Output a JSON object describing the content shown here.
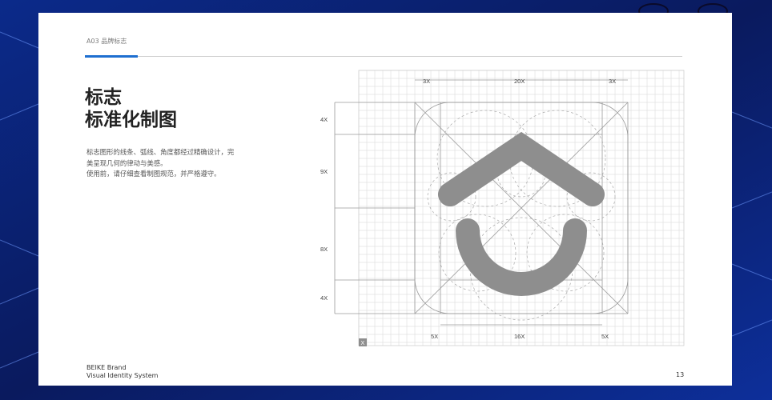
{
  "header": {
    "section_label": "A03 品牌标志"
  },
  "title": {
    "line1": "标志",
    "line2": "标准化制图"
  },
  "description": {
    "lines": [
      "标志图形的线条、弧线、角度都经过精确设计，完",
      "美呈现几何的律动与美感。",
      "使用前，请仔细查看制图规范，并严格遵守。"
    ]
  },
  "drawing": {
    "top_labels": [
      "3X",
      "20X",
      "3X"
    ],
    "left_labels": [
      "4X",
      "9X",
      "8X",
      "4X"
    ],
    "bottom_labels": [
      "5X",
      "16X",
      "5X"
    ],
    "unit_label": "X",
    "logo_color": "#8e8e8e",
    "grid_color": "#d6d6d6"
  },
  "footer": {
    "brand_line1": "BEIKE Brand",
    "brand_line2": "Visual Identity System",
    "page_number": "13"
  },
  "colors": {
    "background": "#0a1f6e",
    "accent": "#1e6fd0",
    "page": "#ffffff"
  }
}
